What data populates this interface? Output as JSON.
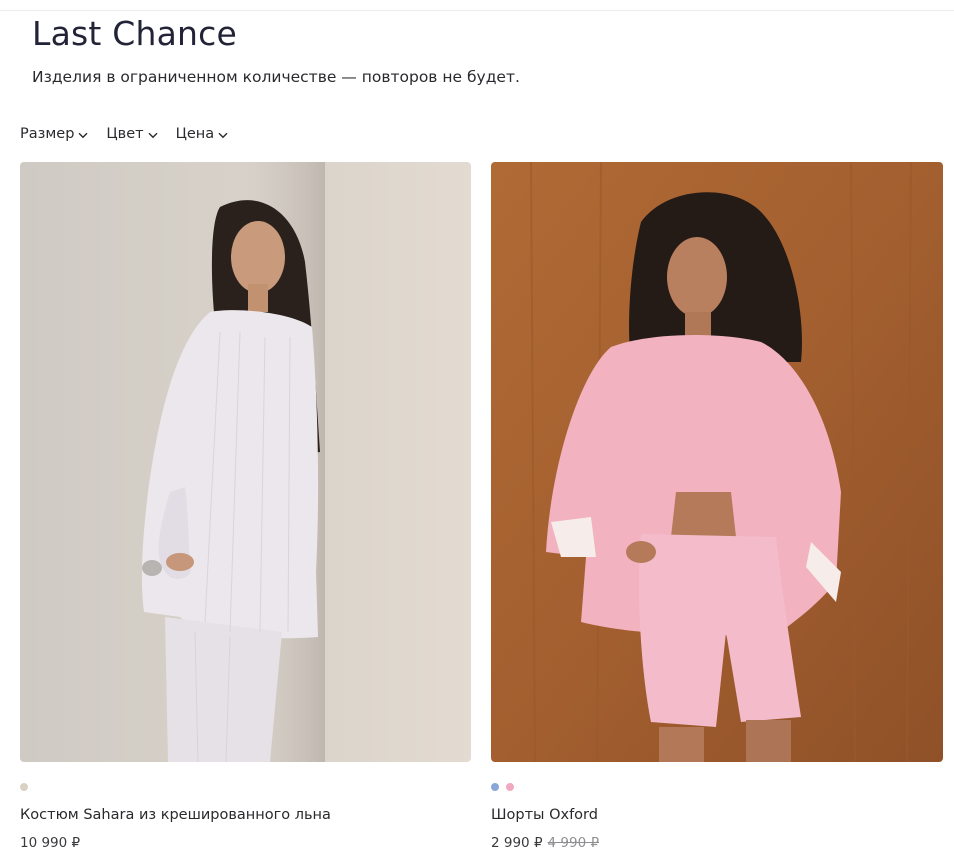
{
  "page": {
    "title": "Last Chance",
    "subtitle": "Изделия в ограниченном количестве — повторов не будет."
  },
  "filters": [
    {
      "label": "Размер",
      "icon": "chevron-down-icon"
    },
    {
      "label": "Цвет",
      "icon": "chevron-down-icon"
    },
    {
      "label": "Цена",
      "icon": "chevron-down-icon"
    }
  ],
  "products": [
    {
      "name": "Костюм Sahara из крешированного льна",
      "price": "10 990 ₽",
      "old_price": "",
      "swatches": [
        "#d9d2c2"
      ],
      "image": "photo of a model in a white crinkled linen shirt and trousers against a beige wall"
    },
    {
      "name": "Шорты Oxford",
      "price": "2 990 ₽",
      "old_price": "4 990 ₽",
      "swatches": [
        "#8aa6d8",
        "#f0a9c1"
      ],
      "image": "photo of a model in a pink oversized shirt and pink shorts against a wooden wall"
    }
  ],
  "colors": {
    "title": "#222336",
    "old_price": "#8e8e93"
  }
}
